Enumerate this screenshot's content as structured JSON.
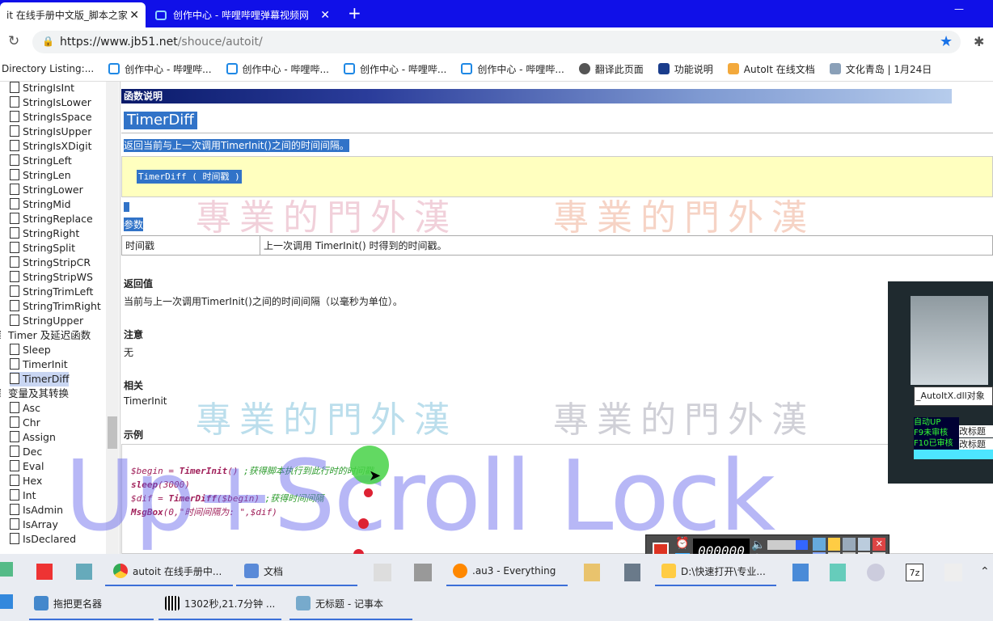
{
  "tabs": [
    {
      "label": "it 在线手册中文版_脚本之家",
      "close": "✕"
    },
    {
      "label": "创作中心 - 哔哩哔哩弹幕视频网",
      "close": "✕"
    }
  ],
  "new_tab": "+",
  "window": {
    "minimize": "—"
  },
  "address": {
    "url_host": "https://www.jb51.net",
    "url_path": "/shouce/autoit/"
  },
  "bookmarks": [
    "Directory Listing:...",
    "创作中心 - 哔哩哔...",
    "创作中心 - 哔哩哔...",
    "创作中心 - 哔哩哔...",
    "创作中心 - 哔哩哔...",
    "翻译此页面",
    "功能说明",
    "AutoIt 在线文档",
    "文化青岛 | 1月24日"
  ],
  "tree": {
    "items": [
      {
        "label": "StringIsInt",
        "type": "doc"
      },
      {
        "label": "StringIsLower",
        "type": "doc"
      },
      {
        "label": "StringIsSpace",
        "type": "doc"
      },
      {
        "label": "StringIsUpper",
        "type": "doc"
      },
      {
        "label": "StringIsXDigit",
        "type": "doc"
      },
      {
        "label": "StringLeft",
        "type": "doc"
      },
      {
        "label": "StringLen",
        "type": "doc"
      },
      {
        "label": "StringLower",
        "type": "doc"
      },
      {
        "label": "StringMid",
        "type": "doc"
      },
      {
        "label": "StringReplace",
        "type": "doc"
      },
      {
        "label": "StringRight",
        "type": "doc"
      },
      {
        "label": "StringSplit",
        "type": "doc"
      },
      {
        "label": "StringStripCR",
        "type": "doc"
      },
      {
        "label": "StringStripWS",
        "type": "doc"
      },
      {
        "label": "StringTrimLeft",
        "type": "doc"
      },
      {
        "label": "StringTrimRight",
        "type": "doc"
      },
      {
        "label": "StringUpper",
        "type": "doc"
      },
      {
        "label": "Timer 及延迟函数",
        "type": "folder"
      },
      {
        "label": "Sleep",
        "type": "doc"
      },
      {
        "label": "TimerInit",
        "type": "doc"
      },
      {
        "label": "TimerDiff",
        "type": "doc",
        "selected": true
      },
      {
        "label": "变量及其转换",
        "type": "folder"
      },
      {
        "label": "Asc",
        "type": "doc"
      },
      {
        "label": "Chr",
        "type": "doc"
      },
      {
        "label": "Assign",
        "type": "doc"
      },
      {
        "label": "Dec",
        "type": "doc"
      },
      {
        "label": "Eval",
        "type": "doc"
      },
      {
        "label": "Hex",
        "type": "doc"
      },
      {
        "label": "Int",
        "type": "doc"
      },
      {
        "label": "IsAdmin",
        "type": "doc"
      },
      {
        "label": "IsArray",
        "type": "doc"
      },
      {
        "label": "IsDeclared",
        "type": "doc"
      }
    ]
  },
  "doc": {
    "section_bar": "函数说明",
    "func_name": "TimerDiff",
    "summary": "返回当前与上一次调用TimerInit()之间的时间间隔。",
    "syntax": "TimerDiff ( 时间戳 )",
    "params_head": "参数",
    "params": [
      {
        "name": "时间戳",
        "desc": "上一次调用 TimerInit() 时得到的时间戳。"
      }
    ],
    "return_head": "返回值",
    "return_text": "当前与上一次调用TimerInit()之间的时间间隔（以毫秒为单位）。",
    "notes_head": "注意",
    "notes_text": "无",
    "related_head": "相关",
    "related_text": "TimerInit",
    "example_head": "示例",
    "code": [
      {
        "a": "$begin = ",
        "b": "TimerInit",
        "c": "() ",
        "comment": ";获得脚本执行到此行时的时间戳"
      },
      {
        "a": "",
        "b": "sleep",
        "c": "(3000)",
        "comment": ""
      },
      {
        "a": "$dif = ",
        "b": "TimerDiff",
        "c": "($begin) ",
        "comment": ";获得时间间隔"
      },
      {
        "a": "",
        "b": "MsgBox",
        "c": "(0,\"时间间隔为: \",$dif)",
        "comment": ""
      }
    ]
  },
  "watermark": {
    "text": "Up+Scroll Lock",
    "seal": "專業的門外漢"
  },
  "side_panel": {
    "dll_label": "_AutoItX.dll对象",
    "lines": [
      "自动UP",
      "F9未审核",
      "F10已审核"
    ],
    "btn1": "改标题",
    "btn2": "改标题"
  },
  "recorder": {
    "counter": "000000"
  },
  "taskbar": {
    "row1": [
      "autoit 在线手册中...",
      "文档",
      ".au3 - Everything",
      "D:\\快速打开\\专业..."
    ],
    "row2": [
      "拖把更名器",
      "1302秒,21.7分钟 ...",
      "无标题 - 记事本"
    ]
  },
  "colors": {
    "tab_bg": "#1010e8",
    "watermark": "#5f5feb",
    "highlight": "#3173c8",
    "syntax_bg": "#ffffbf"
  }
}
